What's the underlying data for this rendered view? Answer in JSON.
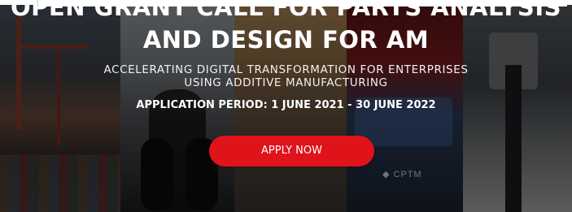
{
  "banner": {
    "title_line_1": "OPEN GRANT CALL FOR PARTS ANALYSIS",
    "title_line_2": "AND DESIGN FOR AM",
    "subtitle_line_1": "ACCELERATING DIGITAL TRANSFORMATION FOR ENTERPRISES",
    "subtitle_line_2": "USING ADDITIVE MANUFACTURING",
    "application_period": "APPLICATION PERIOD: 1 JUNE 2021 - 30 JUNE 2022",
    "apply_button_label": "APPLY NOW",
    "train_logo_text": "◆ CPTM"
  },
  "colors": {
    "accent": "#e0121a",
    "text": "#ffffff",
    "overlay": "#000000"
  }
}
